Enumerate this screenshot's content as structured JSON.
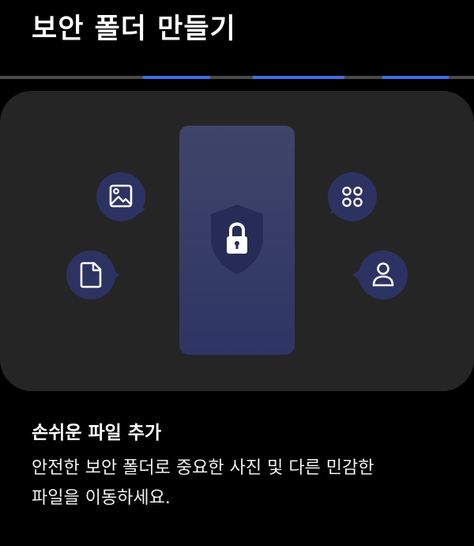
{
  "header": {
    "title": "보안 폴더 만들기"
  },
  "progress": {
    "total_steps": 5,
    "active_steps": [
      2,
      3,
      5
    ],
    "active_color": "#3f6fe0",
    "inactive_color": "#4a4a4a"
  },
  "illustration": {
    "center_icon": "shield-lock-icon",
    "left_icons": [
      "image-icon",
      "document-icon"
    ],
    "right_icons": [
      "apps-grid-icon",
      "person-icon"
    ],
    "accent_color": "#2c3362"
  },
  "content": {
    "heading": "손쉬운 파일 추가",
    "body_line1": "안전한 보안 폴더로 중요한 사진 및 다른 민감한",
    "body_line2": "파일을 이동하세요."
  }
}
